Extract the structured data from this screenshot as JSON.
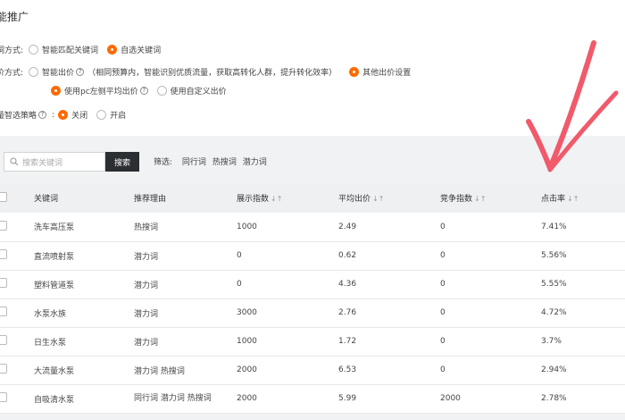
{
  "header": {
    "title": "能推广"
  },
  "match": {
    "label": "词方式:",
    "options": [
      "智能匹配关键词",
      "自选关键词"
    ]
  },
  "bid": {
    "label": "价方式:",
    "smart_label": "智能出价",
    "smart_desc": "（相同预算内，智能识别优质流量，获取高转化人群，提升转化效率）",
    "other_label": "其他出价设置",
    "pc_label": "使用pc左侧平均出价",
    "custom_label": "使用自定义出价"
  },
  "strategy": {
    "label": "量智选策略",
    "options": [
      "关闭",
      "开启"
    ]
  },
  "search": {
    "placeholder": "搜索关键词",
    "button": "搜索"
  },
  "filter": {
    "label": "筛选:",
    "tags": [
      "同行词",
      "热搜词",
      "潜力词"
    ]
  },
  "table": {
    "headers": [
      "关键词",
      "推荐理由",
      "展示指数",
      "平均出价",
      "竞争指数",
      "点击率"
    ],
    "rows": [
      [
        "洗车高压泵",
        "热搜词",
        "1000",
        "2.49",
        "0",
        "7.41%"
      ],
      [
        "直流喷射泵",
        "潜力词",
        "0",
        "0.62",
        "0",
        "5.56%"
      ],
      [
        "塑料管道泵",
        "潜力词",
        "0",
        "4.36",
        "0",
        "5.55%"
      ],
      [
        "水泵水族",
        "潜力词",
        "3000",
        "2.76",
        "0",
        "4.72%"
      ],
      [
        "日生水泵",
        "潜力词",
        "1000",
        "1.72",
        "0",
        "3.7%"
      ],
      [
        "大流量水泵",
        "潜力词 热搜词",
        "2000",
        "6.53",
        "0",
        "2.94%"
      ],
      [
        "自吸清水泵",
        "同行词 潜力词 热搜词",
        "2000",
        "5.99",
        "2000",
        "2.78%"
      ]
    ]
  },
  "colors": {
    "accent": "#ff6a00",
    "annotation": "#f05a6a"
  }
}
